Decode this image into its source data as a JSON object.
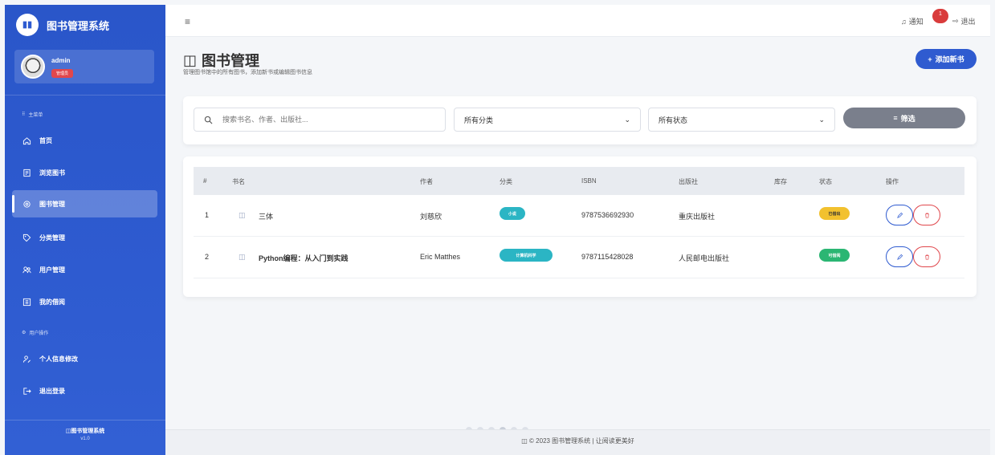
{
  "app": {
    "brand_title": "图书管理系统"
  },
  "user": {
    "name": "admin",
    "role": "管理员"
  },
  "sidebar": {
    "main_section": "主菜单",
    "user_section": "用户操作",
    "items": [
      {
        "label": "首页",
        "icon": "home-icon"
      },
      {
        "label": "浏览图书",
        "icon": "book-list-icon"
      },
      {
        "label": "图书管理",
        "icon": "gear-icon",
        "active": true
      },
      {
        "label": "分类管理",
        "icon": "tag-icon"
      },
      {
        "label": "用户管理",
        "icon": "users-icon"
      },
      {
        "label": "我的借阅",
        "icon": "list-icon"
      }
    ],
    "user_items": [
      {
        "label": "个人信息修改",
        "icon": "user-edit-icon"
      },
      {
        "label": "退出登录",
        "icon": "logout-icon"
      }
    ],
    "footer_title": "图书管理系统",
    "footer_version": "v1.0"
  },
  "topbar": {
    "notifications_label": "通知",
    "notifications_count": "1",
    "logout_label": "退出"
  },
  "header": {
    "title": "图书管理",
    "subtitle": "管理图书馆中的所有图书，添加新书或编辑图书信息",
    "add_button": "添加新书"
  },
  "filters": {
    "search_placeholder": "搜索书名、作者、出版社...",
    "category_value": "所有分类",
    "status_value": "所有状态",
    "filter_button": "筛选"
  },
  "table": {
    "columns": [
      "#",
      "书名",
      "作者",
      "分类",
      "ISBN",
      "出版社",
      "库存",
      "状态",
      "操作"
    ],
    "rows": [
      {
        "index": "1",
        "title": "三体",
        "author": "刘慈欣",
        "category": "小说",
        "category_color": "#2bb5c4",
        "isbn": "9787536692930",
        "publisher": "重庆出版社",
        "stock": "",
        "status": "已借出",
        "status_color": "#f2c12e"
      },
      {
        "index": "2",
        "title": "Python编程：从入门到实践",
        "author": "Eric Matthes",
        "category": "计算机科学",
        "category_color": "#2bb5c4",
        "isbn": "9787115428028",
        "publisher": "人民邮电出版社",
        "stock": "",
        "status": "可借阅",
        "status_color": "#2bb673"
      }
    ]
  },
  "footer": {
    "text": "© 2023 图书管理系统 | 让阅读更美好"
  },
  "colors": {
    "sidebar": "#2e5bd0",
    "accent": "#2f5bd0",
    "danger": "#e0474c"
  }
}
